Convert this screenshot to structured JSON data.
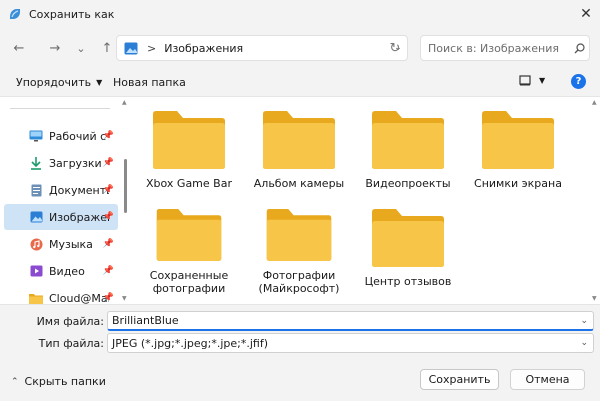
{
  "window": {
    "title": "Сохранить как",
    "close": "✕"
  },
  "nav": {
    "back": "←",
    "forward": "→",
    "recent": "⌄",
    "up": "↑",
    "breadcrumb_sep": ">",
    "location": "Изображения",
    "refresh": "↻"
  },
  "search": {
    "placeholder": "Поиск в: Изображения"
  },
  "toolbar": {
    "organize": "Упорядочить",
    "new_folder": "Новая папка",
    "help": "?"
  },
  "sidebar": {
    "items": [
      {
        "label": "Рабочий стол",
        "icon": "desktop-icon",
        "pinned": true
      },
      {
        "label": "Загрузки",
        "icon": "download-icon",
        "pinned": true
      },
      {
        "label": "Документы",
        "icon": "documents-icon",
        "pinned": true
      },
      {
        "label": "Изображения",
        "icon": "pictures-icon",
        "pinned": true,
        "selected": true
      },
      {
        "label": "Музыка",
        "icon": "music-icon",
        "pinned": true
      },
      {
        "label": "Видео",
        "icon": "video-icon",
        "pinned": true
      },
      {
        "label": "Cloud@Mail.Ru",
        "icon": "folder-icon",
        "pinned": true
      }
    ]
  },
  "folders": [
    {
      "name": "Xbox Game Bar"
    },
    {
      "name": "Альбом камеры"
    },
    {
      "name": "Видеопроекты"
    },
    {
      "name": "Снимки экрана"
    },
    {
      "name": "Сохраненные фотографии"
    },
    {
      "name": "Фотографии (Майкрософт)"
    },
    {
      "name": "Центр отзывов"
    }
  ],
  "form": {
    "filename_label": "Имя файла:",
    "filename_value": "BrilliantBlue",
    "filetype_label": "Тип файла:",
    "filetype_value": "JPEG (*.jpg;*.jpeg;*.jpe;*.jfif)"
  },
  "footer": {
    "hide_folders": "Скрыть папки",
    "save": "Сохранить",
    "cancel": "Отмена"
  },
  "colors": {
    "accent": "#1a73e8",
    "folder": "#f7c548",
    "folder_back": "#e8a91f",
    "selection": "#cfe3f6"
  }
}
